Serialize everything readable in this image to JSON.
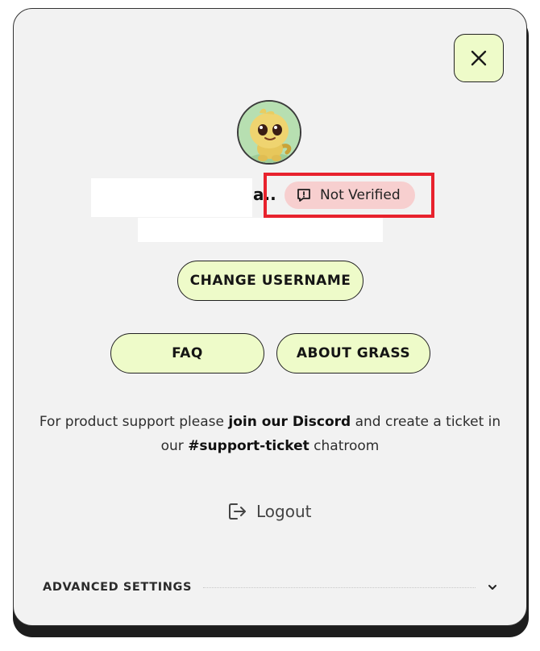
{
  "profile": {
    "username_tail": "a..",
    "verification_badge": "Not Verified"
  },
  "buttons": {
    "change_username": "CHANGE USERNAME",
    "faq": "FAQ",
    "about": "ABOUT GRASS"
  },
  "support": {
    "text_1": "For product support please ",
    "link_discord": "join our Discord",
    "text_2": " and create a ticket in our ",
    "channel": "#support-ticket",
    "text_3": " chatroom"
  },
  "logout_label": "Logout",
  "advanced_settings_label": "ADVANCED SETTINGS",
  "colors": {
    "button_bg": "#eefbc9",
    "badge_bg": "#f7cfcf",
    "highlight": "#e8222d",
    "panel_bg": "#f2f2f2"
  },
  "icons": {
    "close": "close-icon",
    "badge": "alert-message-icon",
    "logout": "logout-icon",
    "expand": "chevron-down-icon"
  }
}
